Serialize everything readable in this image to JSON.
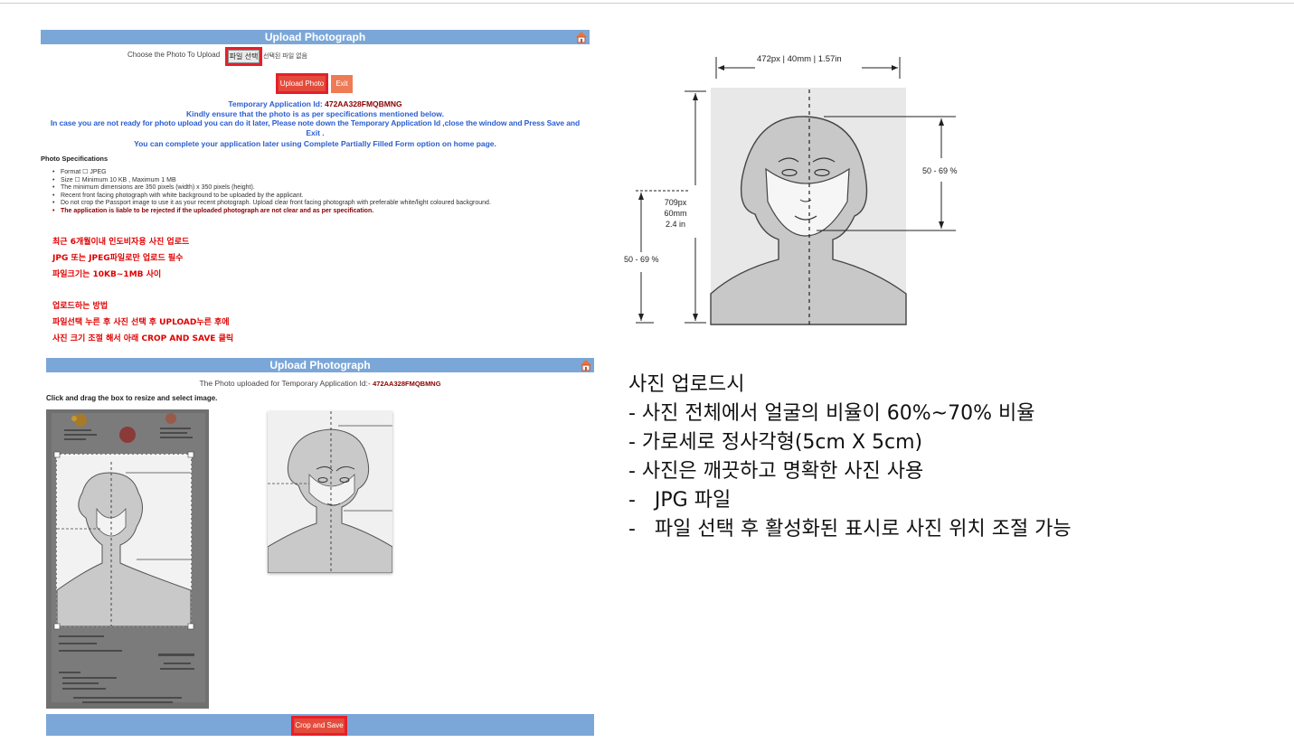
{
  "top_panel": {
    "title": "Upload Photograph",
    "choose_label": "Choose the Photo To Upload",
    "file_button": "파일 선택",
    "no_file_text": "선택된 파일 없음",
    "upload_button": "Upload Photo",
    "exit_button": "Exit",
    "temp_id_label": "Temporary Application Id: ",
    "temp_id_value": "472AA328FMQBMNG",
    "notice_lines": [
      "Kindly ensure that the photo is as per specifications mentioned below.",
      "In case you are not ready for photo upload you can do it later, Please note down the Temporary Application Id ,close the window and Press Save and",
      "Exit .",
      "You can complete your application later using Complete Partially Filled Form option on home page."
    ],
    "spec_title": "Photo Specifications",
    "specs": [
      "Format ☐ JPEG",
      "Size ☐ Minimum 10 KB , Maximum 1 MB",
      "The minimum dimensions are 350 pixels (width) x 350 pixels (height).",
      "Recent front facing photograph with white background to be uploaded by the applicant.",
      "Do not crop the Passport image to use it as your recent photograph. Upload clear front facing photograph with preferable white/light coloured background."
    ],
    "spec_warning": "The application is liable to be rejected if the uploaded photograph are not clear and as per specification.",
    "korean_notes_1": [
      "최근 6개월이내 인도비자용 사진 업로드",
      "JPG 또는 JPEG파일로만 업로드 필수",
      "파일크기는 10KB~1MB 사이"
    ],
    "korean_notes_2": [
      "업로드하는 방법",
      "파일선택 누른 후 사진 선택 후 UPLOAD누른 후에",
      "사진 크기 조절 해서 아래 CROP AND SAVE 클릭"
    ]
  },
  "bottom_panel": {
    "title": "Upload Photograph",
    "uploaded_label": "The Photo uploaded for Temporary Application Id:- ",
    "uploaded_id": "472AA328FMQBMNG",
    "instruction": "Click and drag the box to resize and select image.",
    "crop_button": "Crop and Save"
  },
  "diagram": {
    "width_label": "472px | 40mm | 1.57in",
    "height_label_1": "709px",
    "height_label_2": "60mm",
    "height_label_3": "2.4 in",
    "ratio_right": "50 - 69 %",
    "ratio_left": "50 - 69 %"
  },
  "notes": {
    "title": "사진 업로드시",
    "lines": [
      "- 사진 전체에서 얼굴의 비율이 60%~70% 비율",
      "- 가로세로 정사각형(5cm X 5cm)",
      "- 사진은 깨끗하고 명확한 사진 사용",
      "-   JPG 파일",
      "-   파일 선택 후 활성화된 표시로 사진 위치 조절 가능"
    ]
  },
  "colors": {
    "header_bar": "#7ba7d8",
    "accent_red": "#e5202a",
    "notice_blue": "#2a5ed0",
    "button_red": "#e34b3b"
  },
  "icons": {
    "home": "home-icon"
  }
}
